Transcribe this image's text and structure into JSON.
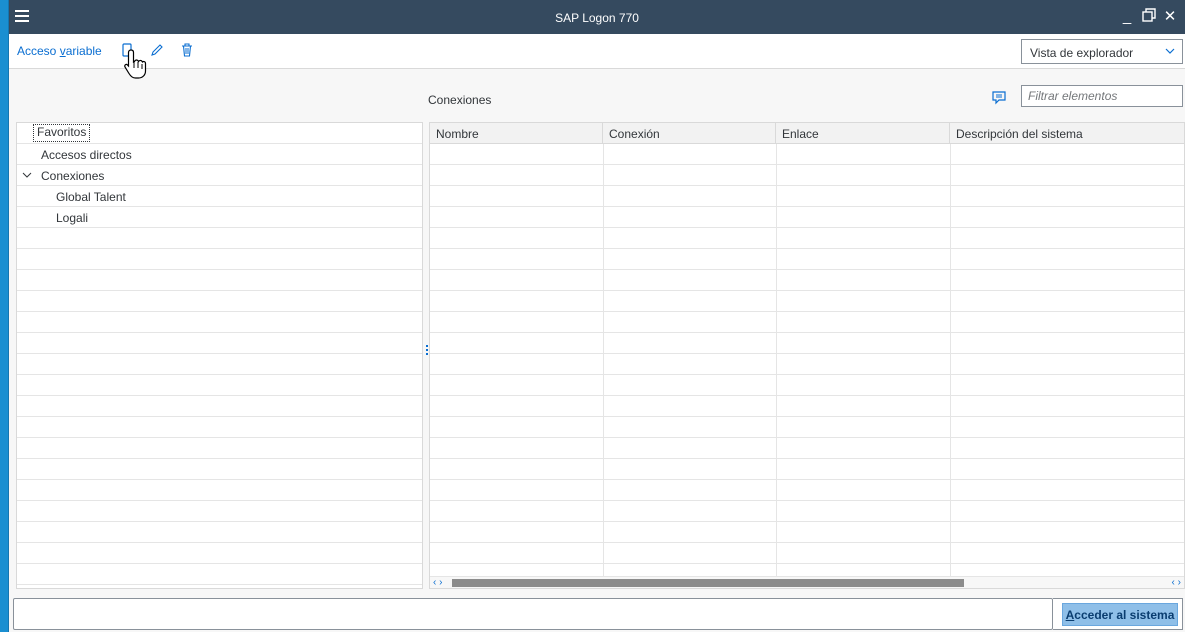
{
  "window": {
    "title": "SAP Logon 770"
  },
  "titlebar": {
    "minimize": "_",
    "maximize": "🗗",
    "close": "✕"
  },
  "toolbar": {
    "acceso_prefix": "Acceso ",
    "acceso_underlined": "v",
    "acceso_suffix": "ariable",
    "icons": [
      "new-item-icon",
      "edit-pencil-icon",
      "delete-trash-icon"
    ],
    "view_select": {
      "value": "Vista de explorador"
    }
  },
  "header": {
    "title": "Conexiones",
    "filter_placeholder": "Filtrar elementos"
  },
  "tree": {
    "items": [
      {
        "label": "Favoritos"
      },
      {
        "label": "Accesos directos"
      },
      {
        "label": "Conexiones"
      },
      {
        "label": "Global Talent"
      },
      {
        "label": "Logali"
      }
    ]
  },
  "table": {
    "columns": [
      "Nombre",
      "Conexión",
      "Enlace",
      "Descripción del sistema"
    ],
    "rows": []
  },
  "footer": {
    "button_underlined": "A",
    "button_rest": "cceder al sistema"
  },
  "colors": {
    "titlebar": "#354a5f",
    "accent": "#0a6ed1",
    "background": "#1a8fd1"
  }
}
